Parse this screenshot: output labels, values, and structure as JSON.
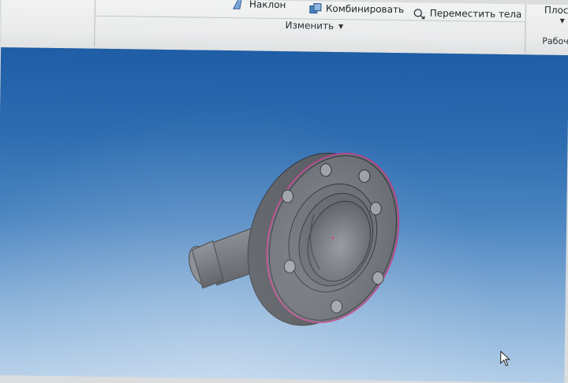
{
  "ribbon": {
    "naklon_label": "Наклон",
    "combine_label": "Комбинировать",
    "move_bodies_label": "Переместить тела",
    "group_label": "Изменить",
    "plane_label": "Плоск",
    "work_label": "Рабочи"
  },
  "colors": {
    "accent": "#2f66b3",
    "edge_highlight": "#c03a8a"
  },
  "icons": {
    "naklon": "draft-icon",
    "combine": "combine-icon",
    "move": "move-bodies-icon",
    "cursor": "mouse-pointer-icon"
  }
}
